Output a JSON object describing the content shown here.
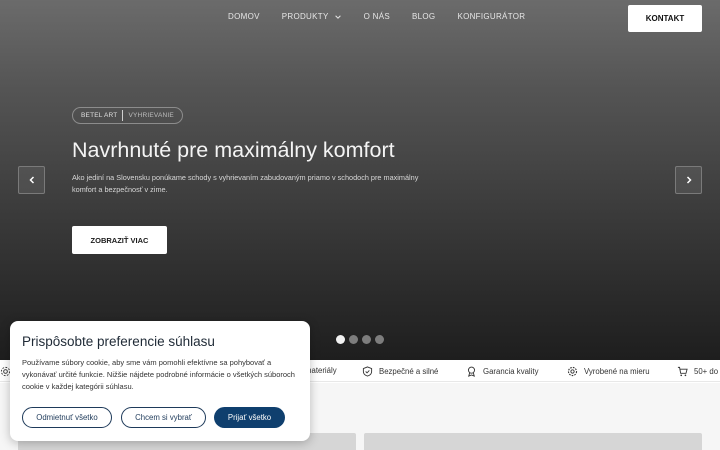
{
  "nav": {
    "links": [
      {
        "label": "DOMOV"
      },
      {
        "label": "PRODUKTY"
      },
      {
        "label": "O NÁS"
      },
      {
        "label": "BLOG"
      },
      {
        "label": "KONFIGURÁTOR"
      }
    ],
    "contact_label": "KONTAKT"
  },
  "hero": {
    "badge_primary": "BETEL ART",
    "badge_secondary": "VYHRIEVANIE",
    "title": "Navrhnuté pre maximálny komfort",
    "description": "Ako jediní na Slovensku ponúkame schody s vyhrievaním zabudovaným priamo v schodoch pre maximálny komfort a bezpečnosť v zime.",
    "cta_label": "ZOBRAZIŤ VIAC",
    "slides_total": 4,
    "active_slide": 1
  },
  "features": [
    {
      "label": "materiály",
      "icon": "gear-icon"
    },
    {
      "label": "Bezpečné a silné",
      "icon": "shield-check-icon"
    },
    {
      "label": "Garancia kvality",
      "icon": "award-icon"
    },
    {
      "label": "Vyrobené na mieru",
      "icon": "cog-icon"
    },
    {
      "label": "50+ do",
      "icon": "cart-icon"
    }
  ],
  "cookie": {
    "title": "Prispôsobte preferencie súhlasu",
    "text": "Používame súbory cookie, aby sme vám pomohli efektívne sa pohybovať a vykonávať určité funkcie. Nižšie nájdete podrobné informácie o všetkých súboroch cookie v každej kategórii súhlasu.",
    "reject_label": "Odmietnuť všetko",
    "choose_label": "Chcem si vybrať",
    "accept_label": "Prijať všetko"
  },
  "colors": {
    "accent": "#0f3f6e",
    "hero_dark": "#1e1e1e"
  }
}
